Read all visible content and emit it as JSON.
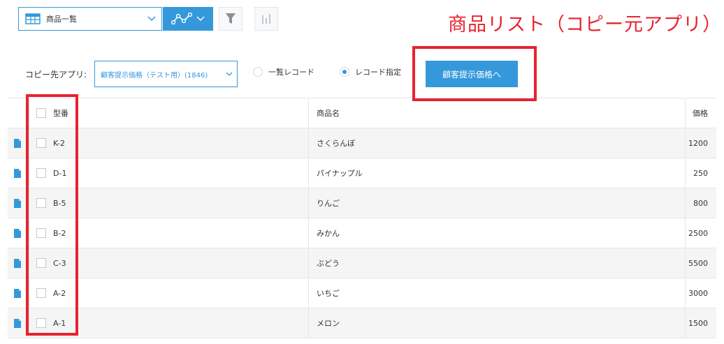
{
  "toolbar": {
    "view_label": "商品一覧"
  },
  "annotation": {
    "title": "商品リスト（コピー元アプリ）"
  },
  "copy": {
    "label": "コピー先アプリ:",
    "selected_app": "顧客提示価格（テスト用）(1846)",
    "radio_list": "一覧レコード",
    "radio_specify": "レコード指定",
    "radio_selected": "レコード指定",
    "submit_label": "顧客提示価格へ"
  },
  "table": {
    "headers": {
      "code": "型番",
      "name": "商品名",
      "price": "価格"
    },
    "rows": [
      {
        "code": "K-2",
        "name": "さくらんぼ",
        "price": "1200"
      },
      {
        "code": "D-1",
        "name": "パイナップル",
        "price": "250"
      },
      {
        "code": "B-5",
        "name": "りんご",
        "price": "800"
      },
      {
        "code": "B-2",
        "name": "みかん",
        "price": "2500"
      },
      {
        "code": "C-3",
        "name": "ぶどう",
        "price": "5500"
      },
      {
        "code": "A-2",
        "name": "いちご",
        "price": "3000"
      },
      {
        "code": "A-1",
        "name": "メロン",
        "price": "1500"
      }
    ]
  },
  "colors": {
    "accent": "#3498db",
    "annotation": "#e8232f"
  }
}
